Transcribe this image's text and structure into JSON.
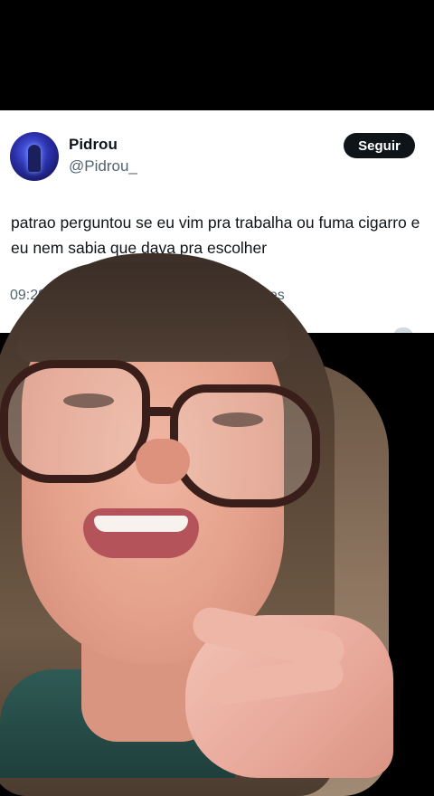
{
  "tweet": {
    "author_name": "Pidrou",
    "author_handle": "@Pidrou_",
    "follow_label": "Seguir",
    "text": "patrao perguntou se eu vim pra trabalha ou fuma cigarro  e eu nem sabia que dava pra escolher",
    "time_partial": "09:29",
    "views_partial": "lizações"
  },
  "icons": {
    "avatar": "avatar-image",
    "more": "more-icon"
  },
  "colors": {
    "card_bg": "#ffffff",
    "button_bg": "#0f1419",
    "secondary_text": "#536471"
  }
}
